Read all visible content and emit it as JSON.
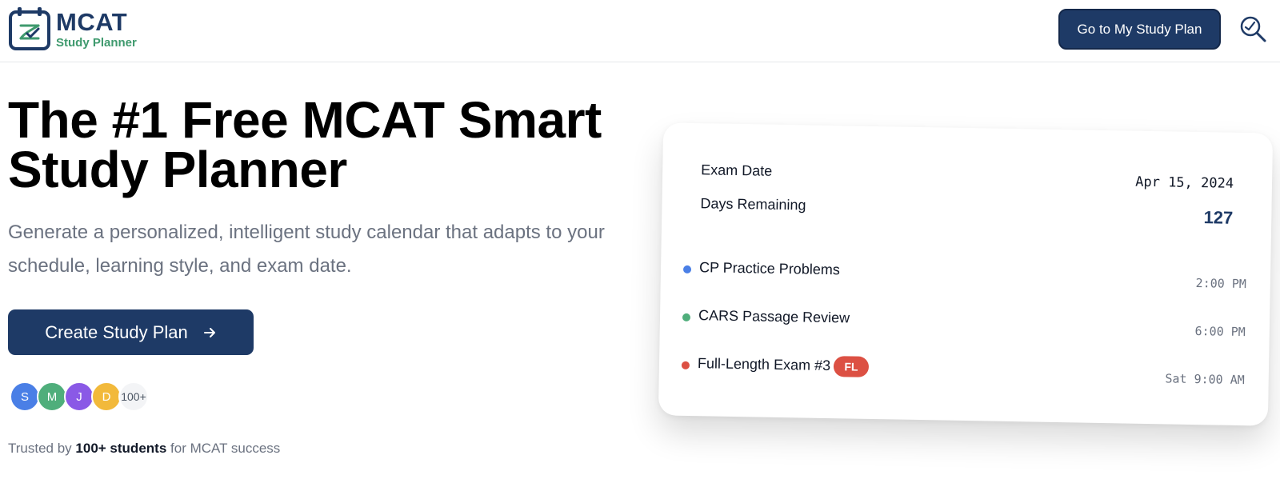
{
  "header": {
    "logo_title": "MCAT",
    "logo_subtitle": "Study Planner",
    "nav_button": "Go to My Study Plan",
    "search_icon": "magnifier-icon"
  },
  "hero": {
    "title": "The #1 Free MCAT Smart Study Planner",
    "subtitle": "Generate a personalized, intelligent study calendar that adapts to your schedule, learning style, and exam date.",
    "cta_label": "Create Study Plan",
    "avatars": [
      {
        "initial": "S",
        "color": "#4a7fe6"
      },
      {
        "initial": "M",
        "color": "#4fae7b"
      },
      {
        "initial": "J",
        "color": "#8a59e6"
      },
      {
        "initial": "D",
        "color": "#f2b93b"
      }
    ],
    "avatars_more": "100+",
    "trusted_prefix": "Trusted by",
    "trusted_bold": "100+ students",
    "trusted_suffix": "for MCAT success"
  },
  "card": {
    "exam_date_label": "Exam Date",
    "exam_date_value": "Apr 15, 2024",
    "days_remaining_label": "Days Remaining",
    "days_remaining_value": "127",
    "sessions": [
      {
        "title": "CP Practice Problems",
        "time": "2:00 PM",
        "color": "#4a7fe6"
      },
      {
        "title": "CARS Passage Review",
        "time": "6:00 PM",
        "color": "#4fae7b"
      },
      {
        "title": "Full-Length Exam #3",
        "time": "Sat 9:00 AM",
        "color": "#dc5043",
        "badge": "FL"
      }
    ]
  },
  "colors": {
    "brand_navy": "#1e3a66",
    "brand_green": "#3f9a6e"
  }
}
